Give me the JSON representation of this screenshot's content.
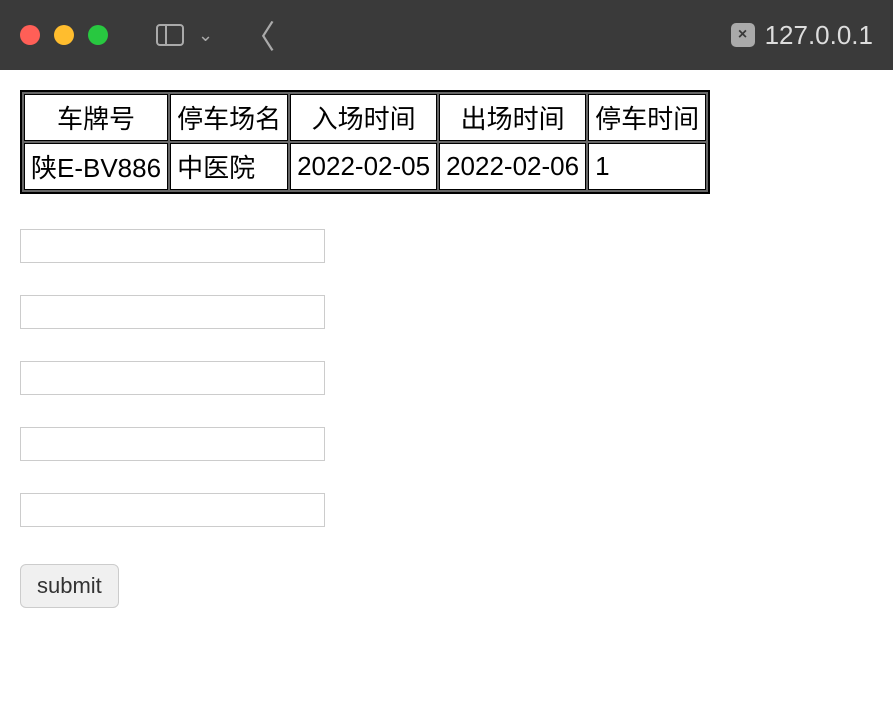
{
  "browser": {
    "url": "127.0.0.1"
  },
  "table": {
    "headers": [
      "车牌号",
      "停车场名",
      "入场时间",
      "出场时间",
      "停车时间"
    ],
    "row": {
      "plate": "陕E-BV886",
      "lot": "中医院",
      "in_time": "2022-02-05",
      "out_time": "2022-02-06",
      "duration": "1"
    }
  },
  "form": {
    "f1": "",
    "f2": "",
    "f3": "",
    "f4": "",
    "f5": "",
    "submit_label": "submit"
  }
}
